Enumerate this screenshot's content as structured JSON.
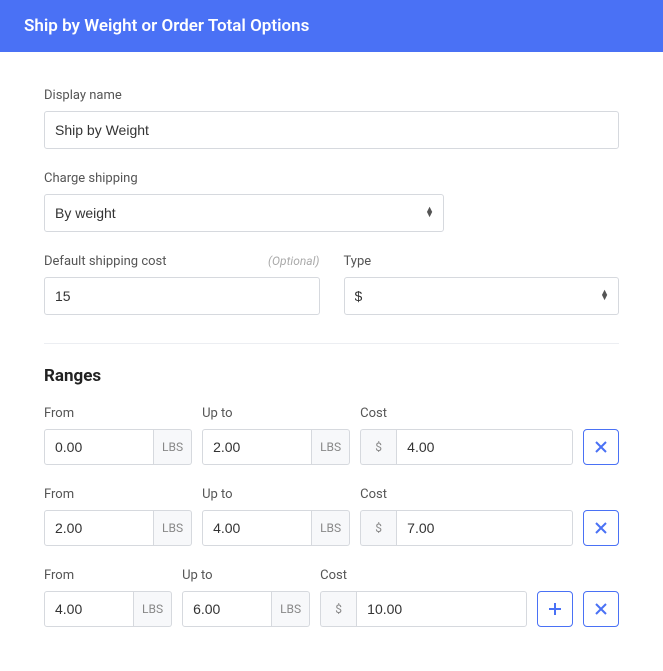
{
  "header": {
    "title": "Ship by Weight or Order Total Options"
  },
  "form": {
    "display_name": {
      "label": "Display name",
      "value": "Ship by Weight"
    },
    "charge_shipping": {
      "label": "Charge shipping",
      "value": "By weight"
    },
    "default_cost": {
      "label": "Default shipping cost",
      "optional": "(Optional)",
      "value": "15"
    },
    "type": {
      "label": "Type",
      "value": "$"
    }
  },
  "ranges": {
    "title": "Ranges",
    "labels": {
      "from": "From",
      "upto": "Up to",
      "cost": "Cost",
      "unit": "LBS",
      "currency": "$"
    },
    "rows": [
      {
        "from": "0.00",
        "upto": "2.00",
        "cost": "4.00"
      },
      {
        "from": "2.00",
        "upto": "4.00",
        "cost": "7.00"
      },
      {
        "from": "4.00",
        "upto": "6.00",
        "cost": "10.00"
      }
    ]
  }
}
